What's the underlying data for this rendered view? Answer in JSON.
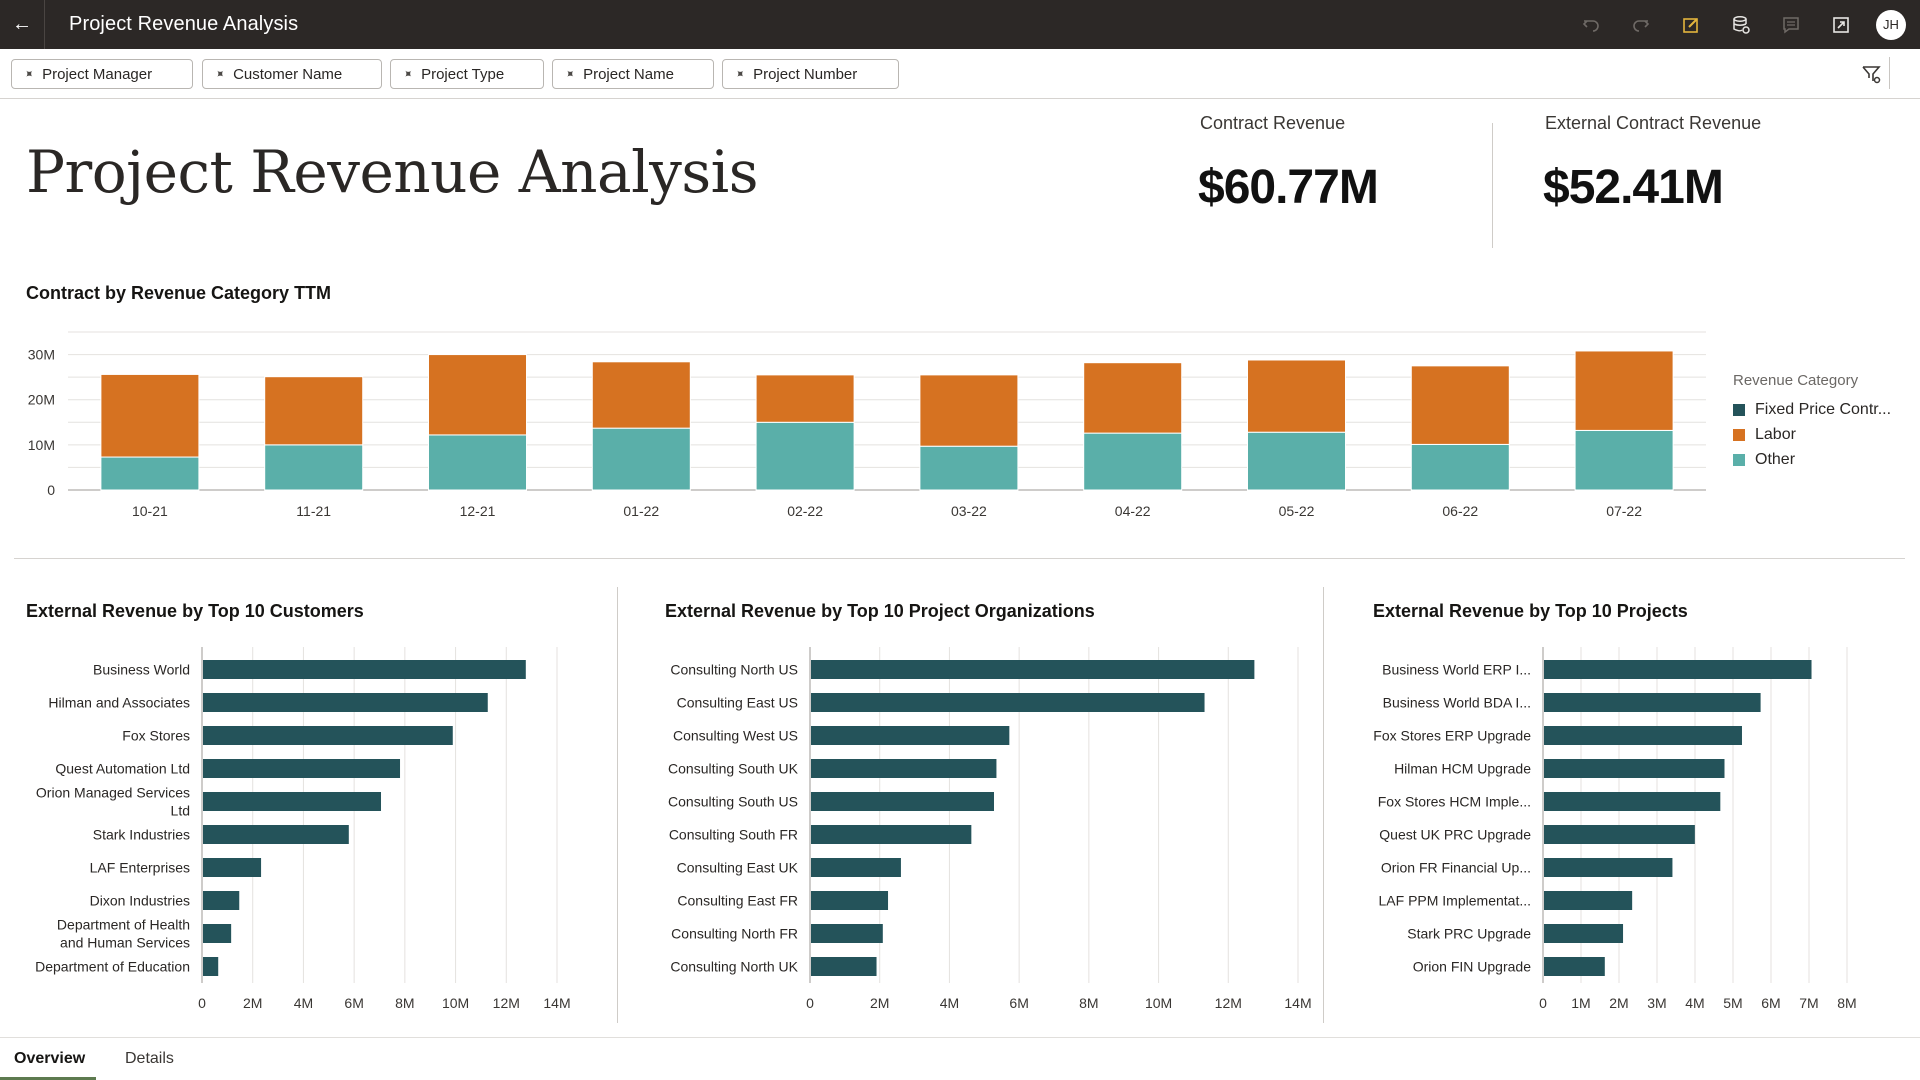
{
  "header": {
    "title": "Project Revenue Analysis",
    "back_icon": "arrow-left-icon",
    "tools": [
      {
        "name": "undo",
        "icon": "undo-icon",
        "enabled": false
      },
      {
        "name": "redo",
        "icon": "redo-icon",
        "enabled": false
      },
      {
        "name": "edit",
        "icon": "edit-icon",
        "enabled": true,
        "color": "#e3b53c"
      },
      {
        "name": "data-refresh",
        "icon": "database-refresh-icon",
        "enabled": true
      },
      {
        "name": "comments",
        "icon": "comment-icon",
        "enabled": false
      },
      {
        "name": "present",
        "icon": "expand-icon",
        "enabled": true
      }
    ],
    "user_initials": "JH"
  },
  "filters": {
    "chips": [
      {
        "label": "Project Manager"
      },
      {
        "label": "Customer Name"
      },
      {
        "label": "Project Type"
      },
      {
        "label": "Project Name"
      },
      {
        "label": "Project Number"
      }
    ]
  },
  "page": {
    "title": "Project Revenue Analysis"
  },
  "kpis": [
    {
      "label": "Contract Revenue",
      "value": "$60.77M"
    },
    {
      "label": "External Contract Revenue",
      "value": "$52.41M"
    }
  ],
  "colors": {
    "fixed_price": "#24535a",
    "labor": "#d67221",
    "other": "#5aafa9",
    "bar": "#24535a",
    "header_bg": "#2c2826",
    "tab_accent": "#5d7a4f"
  },
  "chart_data": [
    {
      "type": "bar",
      "stacked": true,
      "title": "Contract by Revenue Category TTM",
      "categories": [
        "10-21",
        "11-21",
        "12-21",
        "01-22",
        "02-22",
        "03-22",
        "04-22",
        "05-22",
        "06-22",
        "07-22"
      ],
      "series": [
        {
          "name": "Fixed Price Contr...",
          "values": [
            0,
            0,
            0,
            0,
            0,
            0,
            0,
            0,
            0,
            0
          ]
        },
        {
          "name": "Other",
          "values": [
            7.3,
            10.0,
            12.2,
            13.7,
            15.0,
            9.7,
            12.6,
            12.8,
            10.1,
            13.2
          ]
        },
        {
          "name": "Labor",
          "values": [
            18.3,
            15.1,
            17.8,
            14.7,
            10.5,
            15.8,
            15.6,
            16.0,
            17.4,
            17.6
          ]
        }
      ],
      "units": "M",
      "yticks": [
        "0",
        "10M",
        "20M",
        "30M"
      ],
      "ytick_values": [
        0,
        10,
        20,
        30
      ],
      "ylim": [
        0,
        35
      ],
      "grid": true,
      "legend": {
        "title": "Revenue Category",
        "position": "right",
        "entries": [
          "Fixed Price Contr...",
          "Labor",
          "Other"
        ]
      }
    },
    {
      "type": "bar",
      "orientation": "horizontal",
      "title": "External Revenue by Top 10 Customers",
      "categories": [
        "Business World",
        "Hilman and Associates",
        "Fox Stores",
        "Quest Automation Ltd",
        "Orion Managed Services Ltd",
        "Stark Industries",
        "LAF Enterprises",
        "Dixon Industries",
        "Department of Health and Human Services",
        "Department of Education"
      ],
      "category_lines": [
        [
          "Business World"
        ],
        [
          "Hilman and Associates"
        ],
        [
          "Fox Stores"
        ],
        [
          "Quest Automation Ltd"
        ],
        [
          "Orion Managed Services",
          "Ltd"
        ],
        [
          "Stark Industries"
        ],
        [
          "LAF Enterprises"
        ],
        [
          "Dixon Industries"
        ],
        [
          "Department of Health",
          "and Human Services"
        ],
        [
          "Department of Education"
        ]
      ],
      "values": [
        12.73,
        11.23,
        9.85,
        7.77,
        7.02,
        5.75,
        2.29,
        1.43,
        1.11,
        0.6
      ],
      "units": "M",
      "xticks": [
        "0",
        "2M",
        "4M",
        "6M",
        "8M",
        "10M",
        "12M",
        "14M"
      ],
      "xtick_values": [
        0,
        2,
        4,
        6,
        8,
        10,
        12,
        14
      ],
      "xlim": [
        0,
        14
      ],
      "grid": true
    },
    {
      "type": "bar",
      "orientation": "horizontal",
      "title": "External Revenue by Top 10 Project Organizations",
      "categories": [
        "Consulting North US",
        "Consulting East US",
        "Consulting West US",
        "Consulting South UK",
        "Consulting South US",
        "Consulting South FR",
        "Consulting East UK",
        "Consulting East FR",
        "Consulting North FR",
        "Consulting North UK"
      ],
      "category_lines": [
        [
          "Consulting North US"
        ],
        [
          "Consulting East US"
        ],
        [
          "Consulting West US"
        ],
        [
          "Consulting South UK"
        ],
        [
          "Consulting South US"
        ],
        [
          "Consulting South FR"
        ],
        [
          "Consulting East UK"
        ],
        [
          "Consulting East FR"
        ],
        [
          "Consulting North FR"
        ],
        [
          "Consulting North UK"
        ]
      ],
      "values": [
        12.72,
        11.29,
        5.69,
        5.32,
        5.25,
        4.6,
        2.58,
        2.21,
        2.06,
        1.88
      ],
      "units": "M",
      "xticks": [
        "0",
        "2M",
        "4M",
        "6M",
        "8M",
        "10M",
        "12M",
        "14M"
      ],
      "xtick_values": [
        0,
        2,
        4,
        6,
        8,
        10,
        12,
        14
      ],
      "xlim": [
        0,
        14
      ],
      "grid": true
    },
    {
      "type": "bar",
      "orientation": "horizontal",
      "title": "External Revenue by Top 10 Projects",
      "categories": [
        "Business World ERP I...",
        "Business World BDA I...",
        "Fox Stores ERP Upgrade",
        "Hilman HCM Upgrade",
        "Fox Stores HCM Imple...",
        "Quest UK PRC Upgrade",
        "Orion FR Financial Up...",
        "LAF PPM Implementat...",
        "Stark PRC Upgrade",
        "Orion FIN Upgrade"
      ],
      "category_lines": [
        [
          "Business World ERP I..."
        ],
        [
          "Business World BDA I..."
        ],
        [
          "Fox Stores ERP Upgrade"
        ],
        [
          "Hilman HCM Upgrade"
        ],
        [
          "Fox Stores HCM Imple..."
        ],
        [
          "Quest UK PRC Upgrade"
        ],
        [
          "Orion FR Financial Up..."
        ],
        [
          "LAF PPM Implementat..."
        ],
        [
          "Stark PRC Upgrade"
        ],
        [
          "Orion FIN Upgrade"
        ]
      ],
      "values": [
        7.04,
        5.7,
        5.21,
        4.75,
        4.64,
        3.97,
        3.38,
        2.32,
        2.08,
        1.6
      ],
      "units": "M",
      "xticks": [
        "0",
        "1M",
        "2M",
        "3M",
        "4M",
        "5M",
        "6M",
        "7M",
        "8M"
      ],
      "xtick_values": [
        0,
        1,
        2,
        3,
        4,
        5,
        6,
        7,
        8
      ],
      "xlim": [
        0,
        8
      ],
      "grid": true
    }
  ],
  "tabs": [
    {
      "label": "Overview",
      "active": true
    },
    {
      "label": "Details",
      "active": false
    }
  ]
}
